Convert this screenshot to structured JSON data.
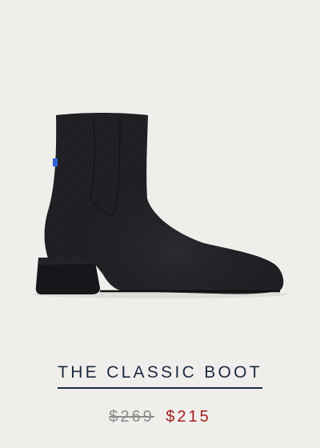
{
  "product": {
    "name": "THE CLASSIC BOOT",
    "original_price": "$269",
    "sale_price": "$215"
  },
  "colors": {
    "background": "#efeeeb",
    "title": "#1d2942",
    "original_price": "#8b8b8b",
    "sale_price": "#a21d1d",
    "boot": "#1b1c1f",
    "boot_tab": "#2f63d6"
  }
}
